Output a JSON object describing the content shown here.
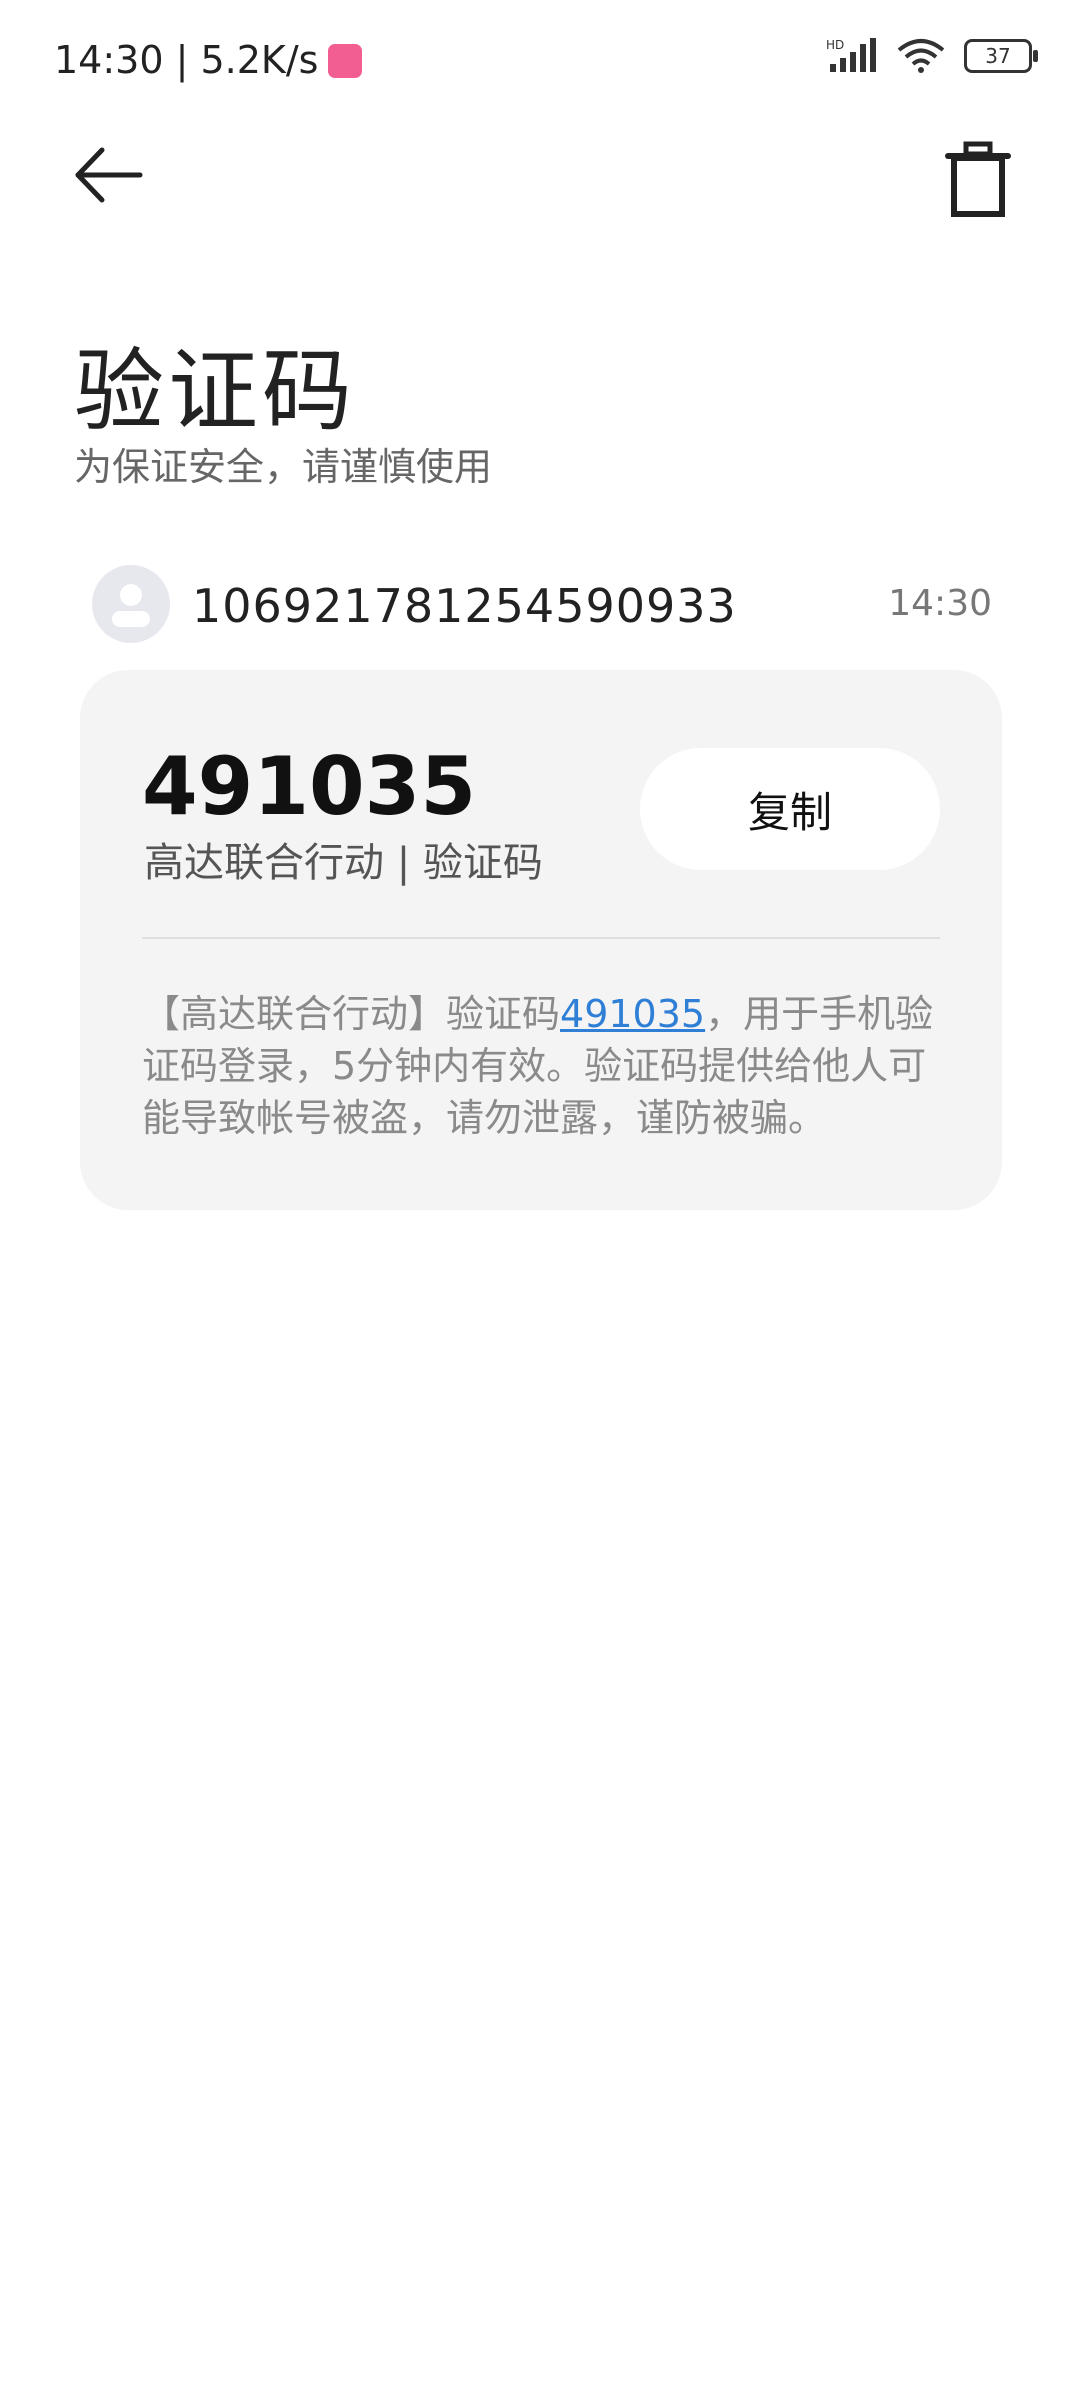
{
  "status_bar": {
    "time_speed": "14:30 | 5.2K/s",
    "battery": "37",
    "signal_label": "HD"
  },
  "header": {
    "title": "验证码",
    "subtitle": "为保证安全，请谨慎使用"
  },
  "message": {
    "sender": "106921781254590933",
    "time": "14:30",
    "code": "491035",
    "label": "高达联合行动 | 验证码",
    "copy_label": "复制",
    "body_prefix": "【高达联合行动】验证码",
    "body_code": "491035",
    "body_suffix": "，用于手机验证码登录，5分钟内有效。验证码提供给他人可能导致帐号被盗，请勿泄露，谨防被骗。"
  },
  "icons": {
    "back": "arrow-left-icon",
    "delete": "trash-icon",
    "avatar": "user-avatar-icon",
    "signal": "signal-icon",
    "wifi": "wifi-icon",
    "battery": "battery-icon"
  },
  "colors": {
    "card_bg": "#f4f4f4",
    "link": "#2f7fd6",
    "badge": "#f25e92"
  }
}
